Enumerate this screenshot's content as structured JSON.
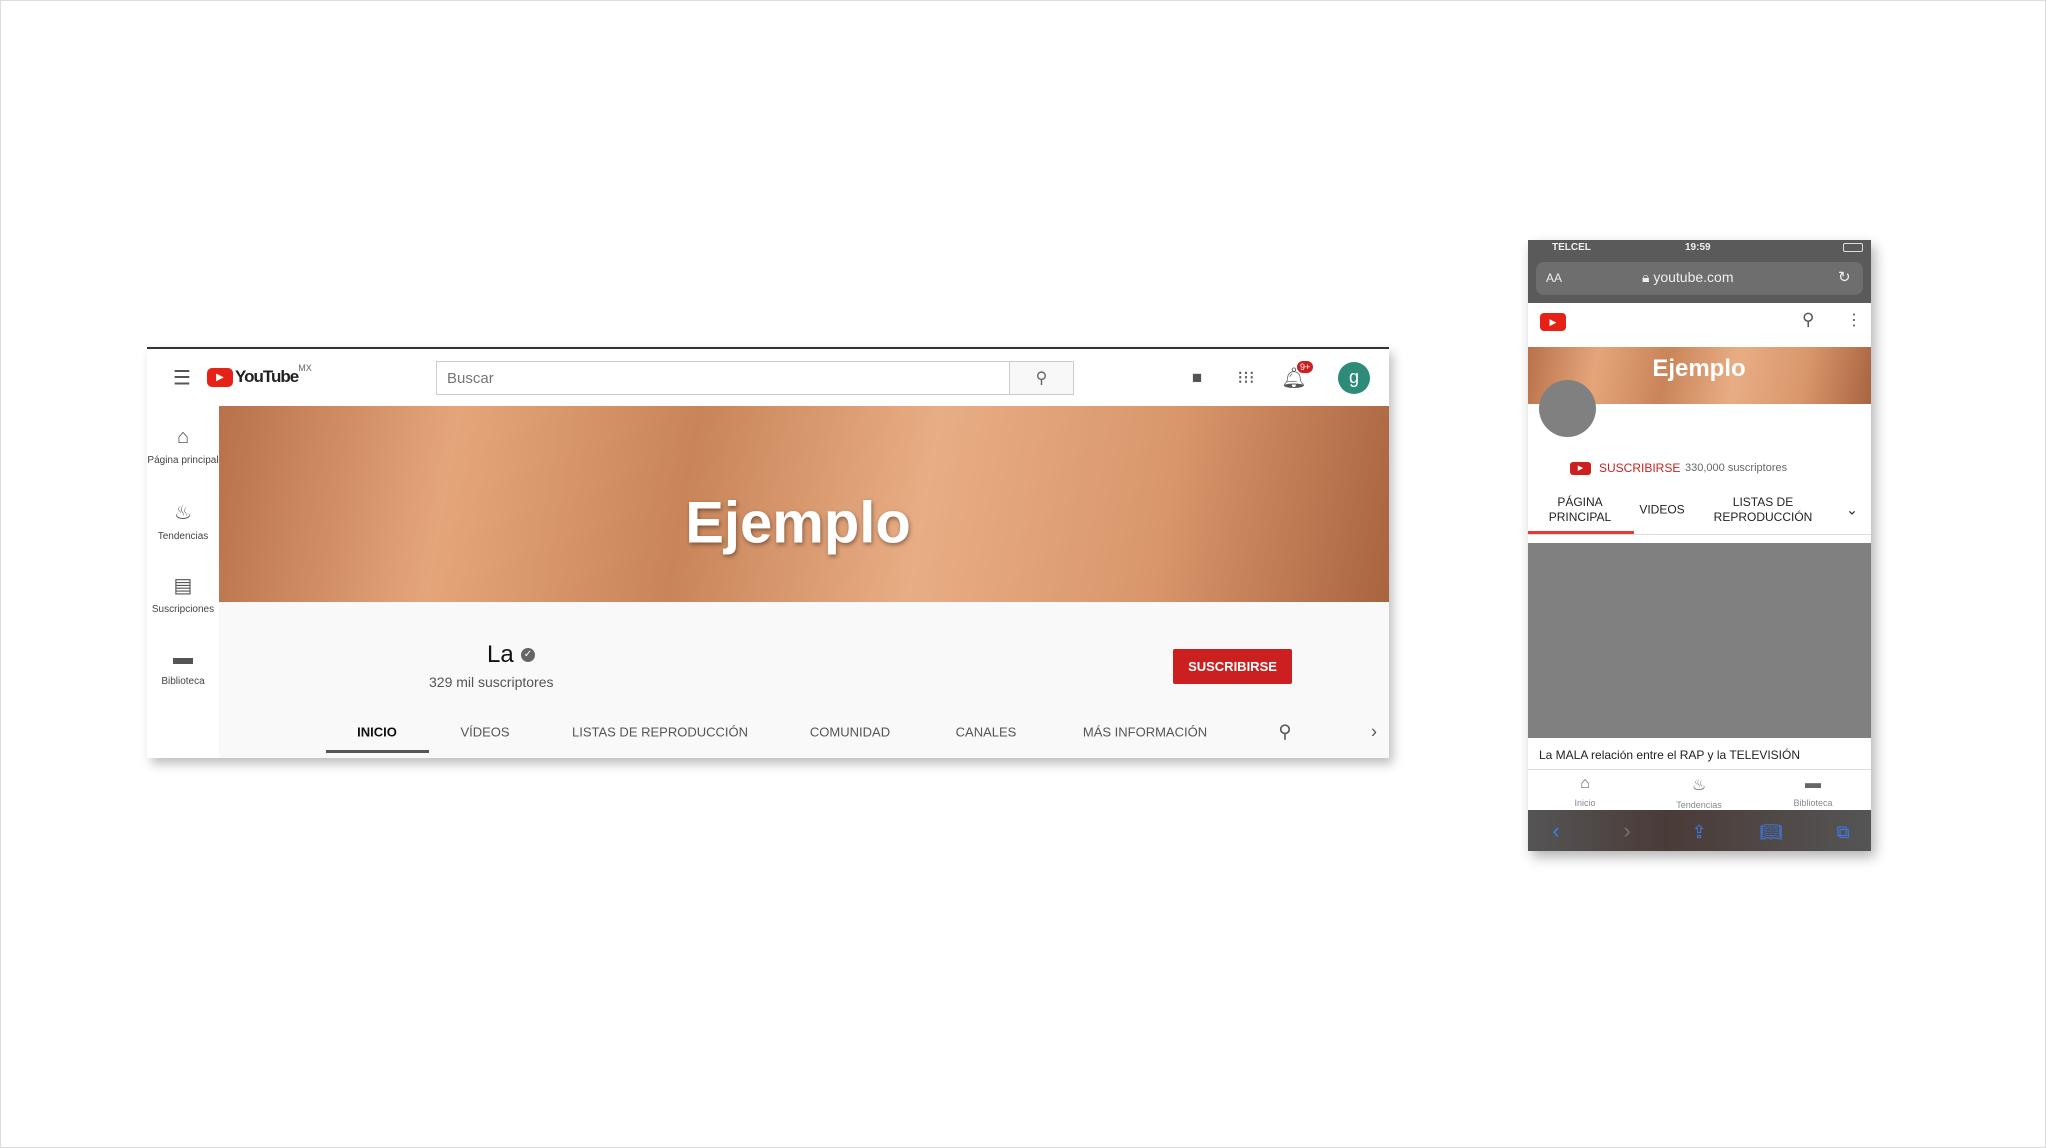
{
  "desktop": {
    "logo": {
      "text": "YouTube",
      "region": "MX"
    },
    "search": {
      "placeholder": "Buscar"
    },
    "notifications_badge": "9+",
    "avatar_letter": "g",
    "sidebar": [
      {
        "label": "Página principal",
        "icon": "home-icon"
      },
      {
        "label": "Tendencias",
        "icon": "fire-icon"
      },
      {
        "label": "Suscripciones",
        "icon": "subscriptions-icon"
      },
      {
        "label": "Biblioteca",
        "icon": "folder-icon"
      }
    ],
    "banner_text": "Ejemplo",
    "channel": {
      "name": "La",
      "subscribers": "329 mil suscriptores"
    },
    "subscribe_label": "SUSCRIBIRSE",
    "tabs": [
      "INICIO",
      "VÍDEOS",
      "LISTAS DE REPRODUCCIÓN",
      "COMUNIDAD",
      "CANALES",
      "MÁS INFORMACIÓN"
    ],
    "active_tab": "INICIO",
    "colors": {
      "brand_red": "#cc1f1f",
      "avatar": "#2e8b7a"
    }
  },
  "mobile": {
    "carrier": "TELCEL",
    "time": "19:59",
    "text_size": "AA",
    "url": "youtube.com",
    "banner_text": "Ejemplo",
    "subscribe_label": "SUSCRIBIRSE",
    "subscribers": "330,000 suscriptores",
    "tabs": [
      "PÁGINA PRINCIPAL",
      "VIDEOS",
      "LISTAS DE REPRODUCCIÓN"
    ],
    "active_tab": "PÁGINA PRINCIPAL",
    "video_title": "La MALA relación entre el RAP y la TELEVISIÓN",
    "bottom_nav": [
      "Inicio",
      "Tendencias",
      "Biblioteca"
    ]
  }
}
